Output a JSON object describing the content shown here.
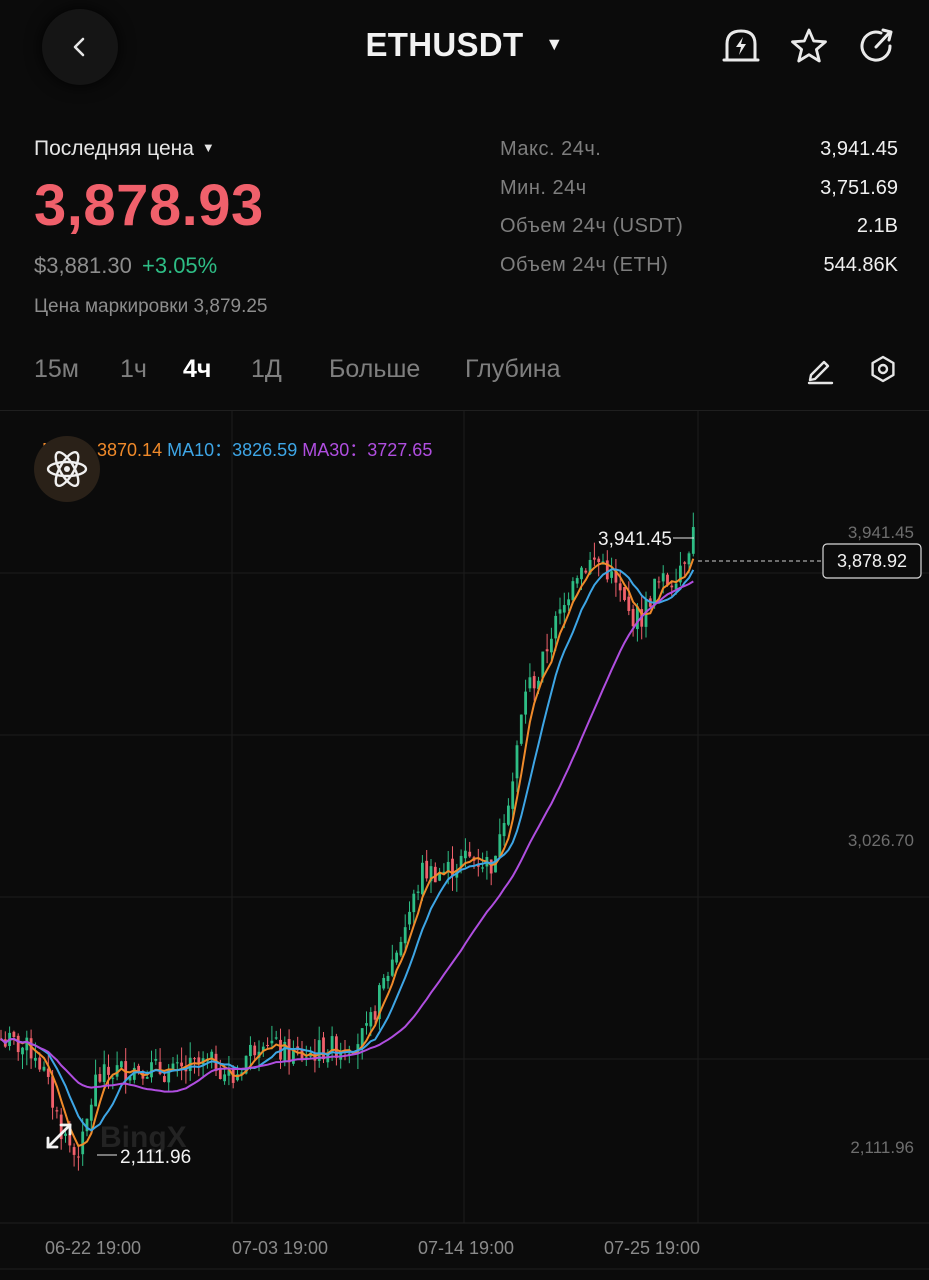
{
  "header": {
    "pair": "ETHUSDT",
    "icons": [
      "back-icon",
      "caret-down-icon",
      "price-alert-icon",
      "star-icon",
      "share-icon"
    ]
  },
  "price": {
    "label": "Последняя цена",
    "last": "3,878.93",
    "usd": "$3,881.30",
    "change": "+3.05%",
    "mark_label": "Цена маркировки",
    "mark_value": "3,879.25",
    "colors": {
      "down": "#f0606b",
      "up": "#2ebd85"
    }
  },
  "stats": [
    {
      "label": "Макс. 24ч.",
      "value": "3,941.45"
    },
    {
      "label": "Мин. 24ч",
      "value": "3,751.69"
    },
    {
      "label": "Объем 24ч (USDT)",
      "value": "2.1B"
    },
    {
      "label": "Объем 24ч (ETH)",
      "value": "544.86K"
    }
  ],
  "timeframes": {
    "items": [
      "15м",
      "1ч",
      "4ч",
      "1Д",
      "Больше",
      "Глубина"
    ],
    "active": "4ч"
  },
  "ma": {
    "ma5_label": "MA5：",
    "ma5_value": "3870.14",
    "ma10_label": "MA10：",
    "ma10_value": "3826.59",
    "ma30_label": "MA30：",
    "ma30_value": "3727.65",
    "colors": {
      "ma5": "#f08a2a",
      "ma10": "#3ea6e6",
      "ma30": "#b04ee0"
    }
  },
  "chart_data": {
    "type": "candlestick",
    "price_axis_labels": [
      "3,941.45",
      "3,026.70",
      "2,111.96"
    ],
    "current_price": "3,878.92",
    "high_marker": "3,941.45",
    "low_marker": "2,111.96",
    "x_tick_labels": [
      "06-22 19:00",
      "07-03 19:00",
      "07-14 19:00",
      "07-25 19:00"
    ],
    "watermark": "BingX",
    "ylim": [
      1950,
      4250
    ],
    "up_color": "#2ebd85",
    "down_color": "#f0606b",
    "close_path": [
      [
        0,
        2480
      ],
      [
        4,
        2460
      ],
      [
        8,
        2440
      ],
      [
        10,
        2380
      ],
      [
        14,
        2220
      ],
      [
        17,
        2150
      ],
      [
        19,
        2180
      ],
      [
        22,
        2360
      ],
      [
        27,
        2390
      ],
      [
        33,
        2400
      ],
      [
        40,
        2380
      ],
      [
        45,
        2400
      ],
      [
        50,
        2410
      ],
      [
        54,
        2360
      ],
      [
        57,
        2430
      ],
      [
        61,
        2490
      ],
      [
        65,
        2440
      ],
      [
        70,
        2430
      ],
      [
        75,
        2450
      ],
      [
        80,
        2460
      ],
      [
        85,
        2490
      ],
      [
        89,
        2640
      ],
      [
        93,
        2770
      ],
      [
        96,
        2880
      ],
      [
        98,
        2960
      ],
      [
        100,
        2960
      ],
      [
        103,
        2960
      ],
      [
        108,
        3000
      ],
      [
        112,
        2990
      ],
      [
        115,
        2980
      ],
      [
        116,
        3090
      ],
      [
        119,
        3220
      ],
      [
        122,
        3490
      ],
      [
        125,
        3520
      ],
      [
        128,
        3650
      ],
      [
        131,
        3720
      ],
      [
        133,
        3820
      ],
      [
        137,
        3850
      ],
      [
        140,
        3850
      ],
      [
        143,
        3780
      ],
      [
        146,
        3700
      ],
      [
        149,
        3690
      ],
      [
        152,
        3780
      ],
      [
        156,
        3800
      ],
      [
        159,
        3870
      ],
      [
        161,
        3941
      ]
    ]
  }
}
